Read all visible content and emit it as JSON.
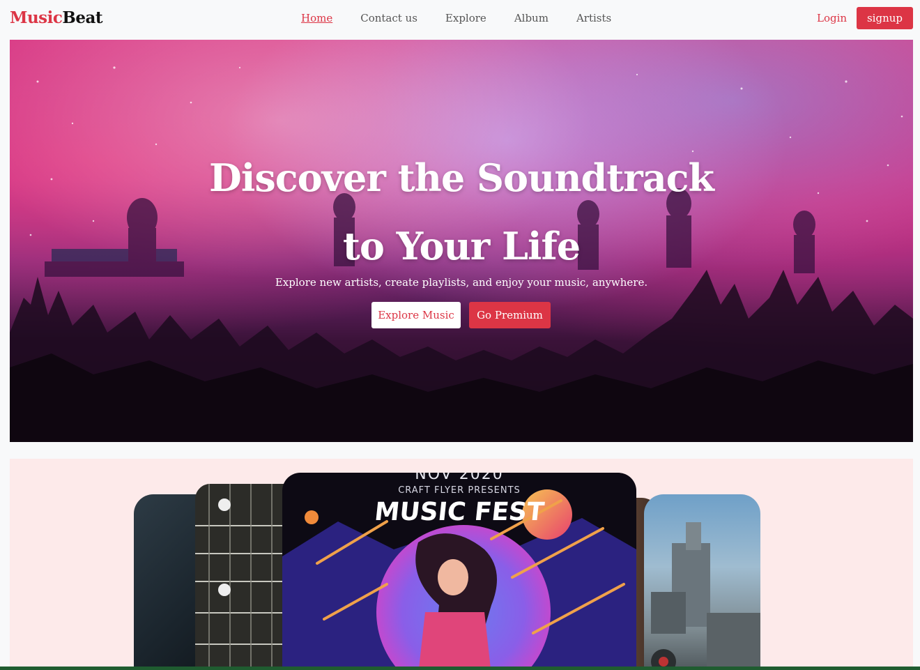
{
  "brand": {
    "part1": "Music",
    "part2": "Beat"
  },
  "nav": {
    "links": [
      {
        "label": "Home",
        "active": true
      },
      {
        "label": "Contact us"
      },
      {
        "label": "Explore"
      },
      {
        "label": "Album"
      },
      {
        "label": "Artists"
      }
    ],
    "login_label": "Login",
    "signup_label": "signup"
  },
  "hero": {
    "title_line1": "Discover the Soundtrack",
    "title_line2": "to Your Life",
    "subtitle": "Explore new artists, create playlists, and enjoy your music, anywhere.",
    "explore_label": "Explore Music",
    "premium_label": "Go Premium"
  },
  "carousel": {
    "featured": {
      "date": "NOV 2020",
      "presents": "CRAFT FLYER PRESENTS",
      "title": "MUSIC FEST"
    }
  },
  "colors": {
    "accent": "#dc3545",
    "hero_pink": "#d6408a",
    "carousel_bg": "#fdeaea"
  }
}
